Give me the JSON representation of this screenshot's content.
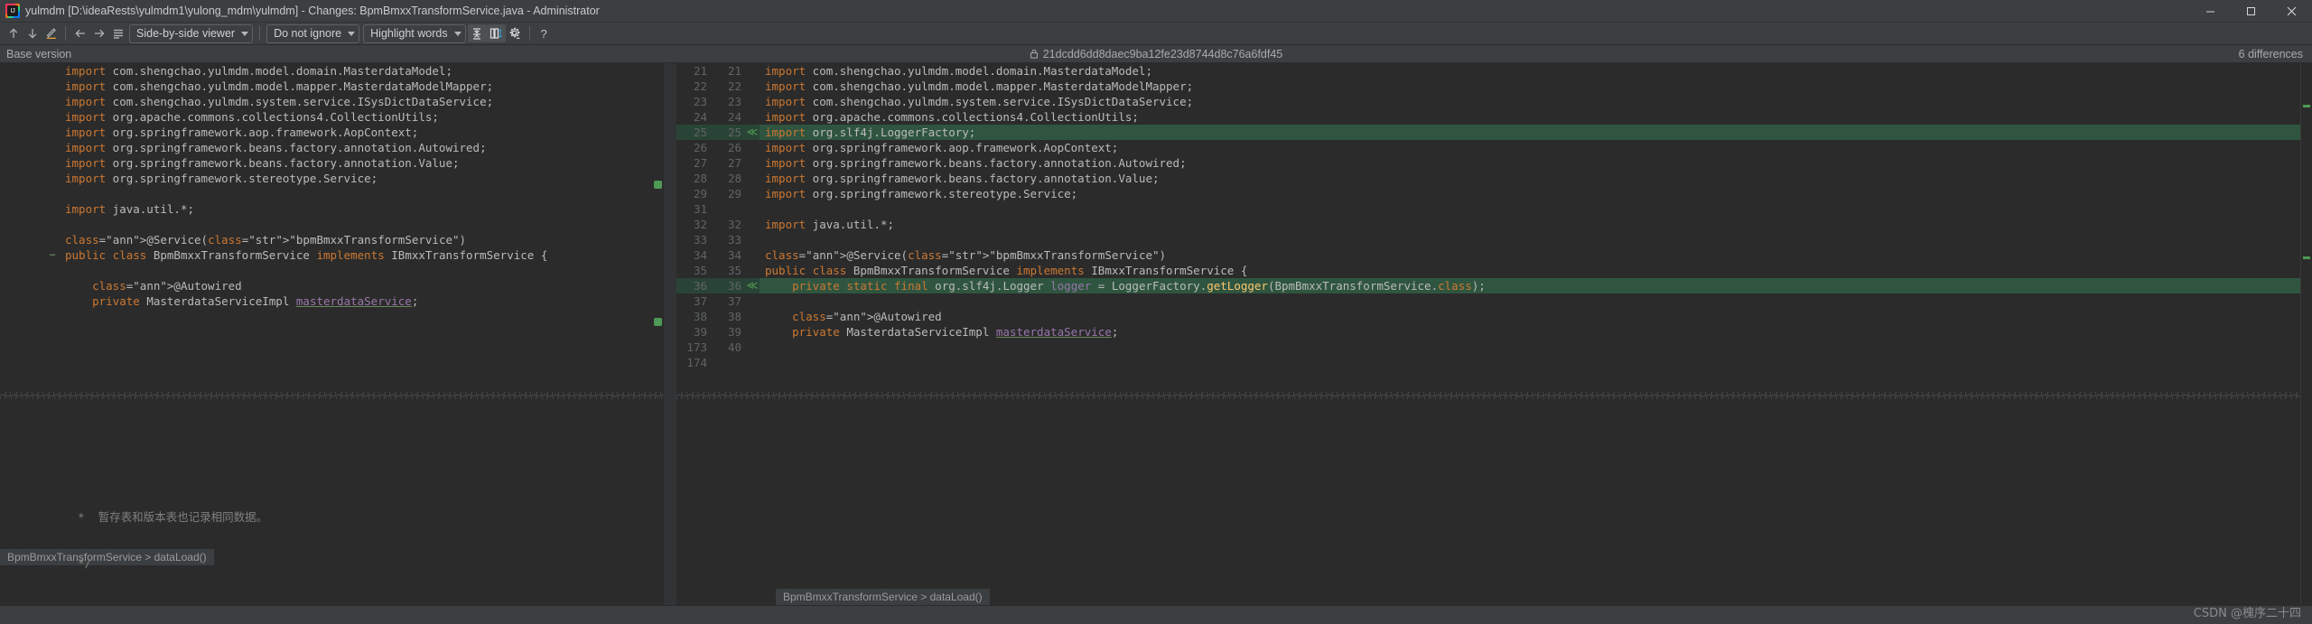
{
  "window": {
    "title": "yulmdm [D:\\ideaRests\\yulmdm1\\yulong_mdm\\yulmdm] - Changes: BpmBmxxTransformService.java - Administrator",
    "icon": "intellij-idea-icon",
    "minimize_label": "—",
    "maximize_label": "❐",
    "close_label": "✕"
  },
  "toolbar": {
    "prev_diff_icon": "arrow-up-icon",
    "next_diff_icon": "arrow-down-icon",
    "edit_icon": "pencil-icon",
    "apply_left_icon": "arrow-left-icon",
    "apply_right_icon": "arrow-right-icon",
    "list_icon": "list-lines-icon",
    "viewer_mode": "Side-by-side viewer",
    "whitespace_mode": "Do not ignore",
    "highlight_mode": "Highlight words",
    "collapse_icon": "collapse-unchanged-icon",
    "align_icon": "align-columns-icon",
    "settings_icon": "gear-icon",
    "help_icon": "help-question-icon"
  },
  "versionbar": {
    "left_label": "Base version",
    "lock_icon": "lock-icon",
    "commit_hash": "21dcdd6dd8daec9ba12fe23d8744d8c76a6fdf45",
    "differences": "6 differences"
  },
  "breadcrumbs": {
    "left": "BpmBmxxTransformService > dataLoad()",
    "right": "BpmBmxxTransformService > dataLoad()"
  },
  "left_pane": {
    "lines": [
      {
        "num": "",
        "type": "normal",
        "text": "import com.shengchao.yulmdm.model.domain.MasterdataModel;"
      },
      {
        "num": "",
        "type": "normal",
        "text": "import com.shengchao.yulmdm.model.mapper.MasterdataModelMapper;"
      },
      {
        "num": "",
        "type": "normal",
        "text": "import com.shengchao.yulmdm.system.service.ISysDictDataService;"
      },
      {
        "num": "",
        "type": "normal",
        "text": "import org.apache.commons.collections4.CollectionUtils;"
      },
      {
        "num": "",
        "type": "normal",
        "text": "import org.springframework.aop.framework.AopContext;"
      },
      {
        "num": "",
        "type": "normal",
        "text": "import org.springframework.beans.factory.annotation.Autowired;"
      },
      {
        "num": "",
        "type": "normal",
        "text": "import org.springframework.beans.factory.annotation.Value;"
      },
      {
        "num": "",
        "type": "normal",
        "text": "import org.springframework.stereotype.Service;"
      },
      {
        "num": "",
        "type": "blank",
        "text": ""
      },
      {
        "num": "",
        "type": "normal",
        "text": "import java.util.*;"
      },
      {
        "num": "",
        "type": "blank",
        "text": ""
      },
      {
        "num": "",
        "type": "normal",
        "text": "@Service(\"bpmBmxxTransformService\")"
      },
      {
        "num": "",
        "type": "normal",
        "text": "public class BpmBmxxTransformService implements IBmxxTransformService {"
      },
      {
        "num": "",
        "type": "blank",
        "text": ""
      },
      {
        "num": "",
        "type": "normal",
        "text": "    @Autowired"
      },
      {
        "num": "",
        "type": "normal",
        "text": "    private MasterdataServiceImpl masterdataService;"
      }
    ],
    "tail": [
      "    *  暂存表和版本表也记录相同数据。",
      "    */"
    ]
  },
  "right_pane": {
    "lines": [
      {
        "old": "21",
        "new": "21",
        "type": "normal",
        "text": "import com.shengchao.yulmdm.model.domain.MasterdataModel;"
      },
      {
        "old": "22",
        "new": "22",
        "type": "normal",
        "text": "import com.shengchao.yulmdm.model.mapper.MasterdataModelMapper;"
      },
      {
        "old": "23",
        "new": "23",
        "type": "normal",
        "text": "import com.shengchao.yulmdm.system.service.ISysDictDataService;"
      },
      {
        "old": "24",
        "new": "24",
        "type": "normal",
        "text": "import org.apache.commons.collections4.CollectionUtils;"
      },
      {
        "old": "25",
        "new": "25",
        "type": "inserted",
        "text": "import org.slf4j.LoggerFactory;"
      },
      {
        "old": "26",
        "new": "26",
        "type": "normal",
        "text": "import org.springframework.aop.framework.AopContext;"
      },
      {
        "old": "27",
        "new": "27",
        "type": "normal",
        "text": "import org.springframework.beans.factory.annotation.Autowired;"
      },
      {
        "old": "28",
        "new": "28",
        "type": "normal",
        "text": "import org.springframework.beans.factory.annotation.Value;"
      },
      {
        "old": "29",
        "new": "29",
        "type": "normal",
        "text": "import org.springframework.stereotype.Service;"
      },
      {
        "old": "31",
        "new": "",
        "type": "blank",
        "text": ""
      },
      {
        "old": "32",
        "new": "32",
        "type": "normal",
        "text": "import java.util.*;"
      },
      {
        "old": "33",
        "new": "33",
        "type": "blank",
        "text": ""
      },
      {
        "old": "34",
        "new": "34",
        "type": "normal",
        "text": "@Service(\"bpmBmxxTransformService\")"
      },
      {
        "old": "35",
        "new": "35",
        "type": "normal",
        "text": "public class BpmBmxxTransformService implements IBmxxTransformService {"
      },
      {
        "old": "36",
        "new": "36",
        "type": "inserted",
        "text": "    private static final org.slf4j.Logger logger = LoggerFactory.getLogger(BpmBmxxTransformService.class);"
      },
      {
        "old": "37",
        "new": "37",
        "type": "blank",
        "text": ""
      },
      {
        "old": "38",
        "new": "38",
        "type": "normal",
        "text": "    @Autowired"
      },
      {
        "old": "39",
        "new": "39",
        "type": "normal",
        "text": "    private MasterdataServiceImpl masterdataService;"
      },
      {
        "old": "173",
        "new": "40",
        "type": "blank",
        "text": ""
      },
      {
        "old": "174",
        "new": "",
        "type": "blank",
        "text": ""
      }
    ]
  },
  "watermark": "CSDN @槐序二十四",
  "colors": {
    "inserted_bg": "#294436",
    "inserted_bg_strong": "#2f5540",
    "editor_bg": "#2b2b2b",
    "chrome_bg": "#3c3f41",
    "keyword": "#cc7832",
    "string": "#6a8759",
    "annotation": "#bbb529",
    "field": "#9876aa",
    "method": "#ffc66d"
  }
}
